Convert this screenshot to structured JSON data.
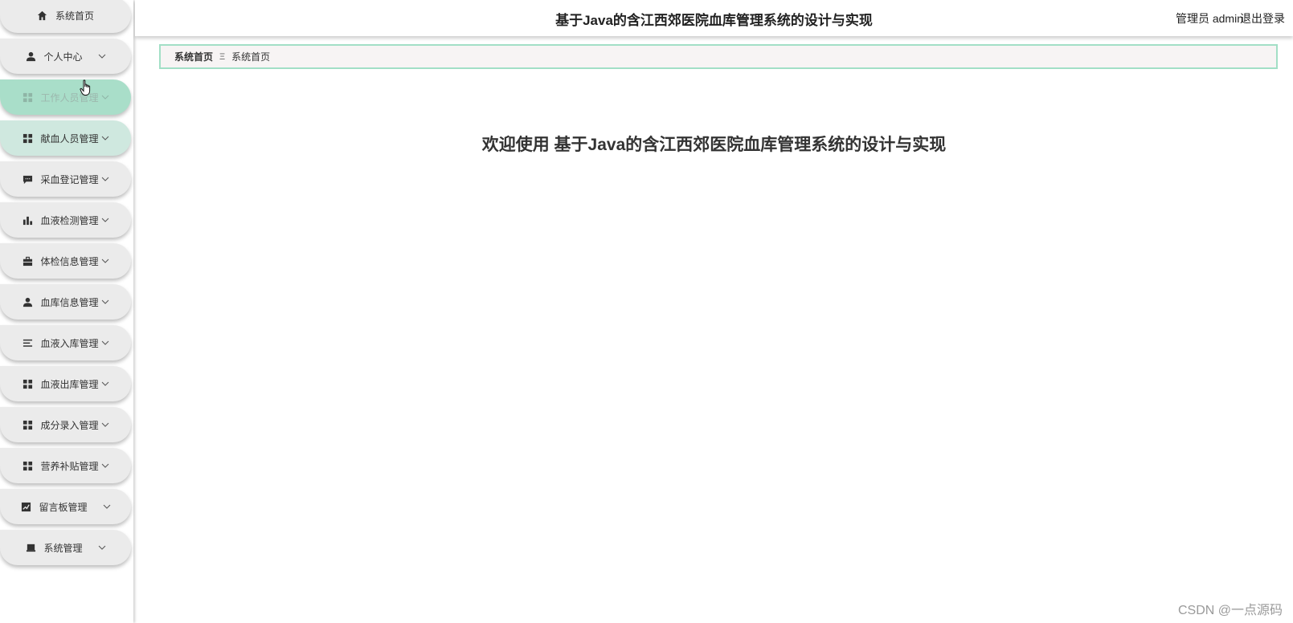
{
  "header": {
    "title": "基于Java的含江西郊医院血库管理系统的设计与实现",
    "user_label": "管理员 admin",
    "logout_label": "退出登录"
  },
  "sidebar": {
    "items": [
      {
        "label": "系统首页",
        "icon": "home-icon"
      },
      {
        "label": "个人中心",
        "icon": "user-icon"
      },
      {
        "label": "工作人员管理",
        "icon": "grid-icon"
      },
      {
        "label": "献血人员管理",
        "icon": "grid-icon"
      },
      {
        "label": "采血登记管理",
        "icon": "chat-icon"
      },
      {
        "label": "血液检测管理",
        "icon": "bar-chart-icon"
      },
      {
        "label": "体检信息管理",
        "icon": "briefcase-icon"
      },
      {
        "label": "血库信息管理",
        "icon": "user-icon"
      },
      {
        "label": "血液入库管理",
        "icon": "list-icon"
      },
      {
        "label": "血液出库管理",
        "icon": "grid-icon"
      },
      {
        "label": "成分录入管理",
        "icon": "grid-icon"
      },
      {
        "label": "营养补贴管理",
        "icon": "grid-icon"
      },
      {
        "label": "留言板管理",
        "icon": "line-chart-icon"
      },
      {
        "label": "系统管理",
        "icon": "monitor-icon"
      }
    ]
  },
  "breadcrumb": {
    "home": "系统首页",
    "separator": "Ξ",
    "current": "系统首页"
  },
  "main": {
    "welcome": "欢迎使用 基于Java的含江西郊医院血库管理系统的设计与实现"
  },
  "watermark": "CSDN @一点源码",
  "colors": {
    "accent": "#a9dec9",
    "breadcrumb_border": "#a2dfc6",
    "menu_bg": "#ebebeb"
  }
}
